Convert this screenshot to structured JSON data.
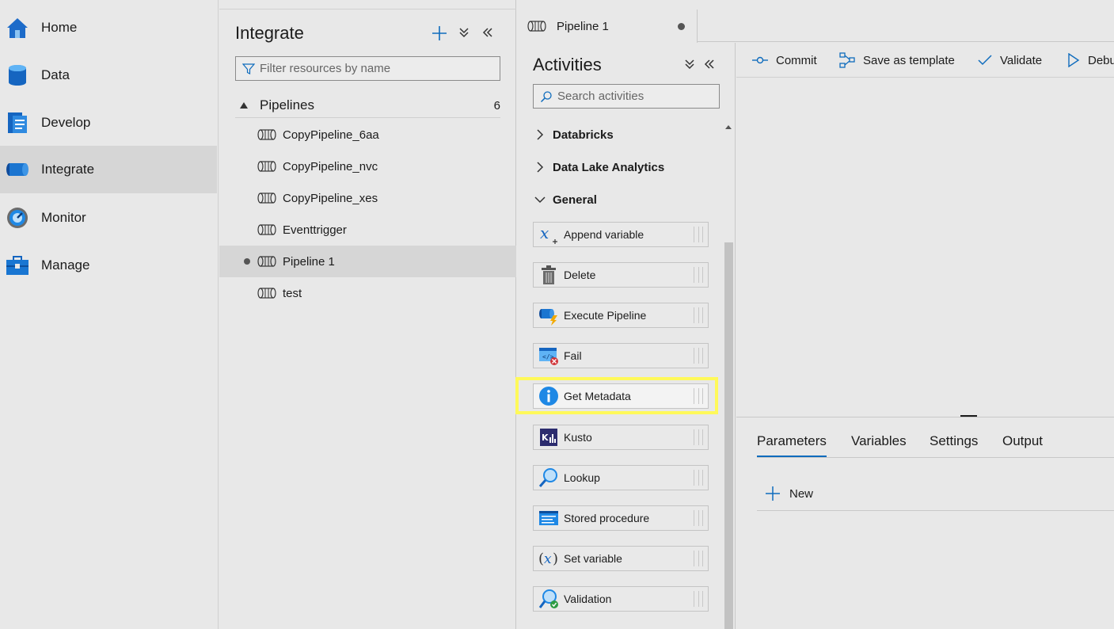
{
  "nav": {
    "items": [
      {
        "label": "Home",
        "icon": "home-icon"
      },
      {
        "label": "Data",
        "icon": "database-icon"
      },
      {
        "label": "Develop",
        "icon": "document-icon"
      },
      {
        "label": "Integrate",
        "icon": "pipeline-icon",
        "active": true
      },
      {
        "label": "Monitor",
        "icon": "gauge-icon"
      },
      {
        "label": "Manage",
        "icon": "toolbox-icon"
      }
    ]
  },
  "integrate": {
    "title": "Integrate",
    "filter_placeholder": "Filter resources by name",
    "section_label": "Pipelines",
    "section_count": "6",
    "pipelines": [
      {
        "label": "CopyPipeline_6aa"
      },
      {
        "label": "CopyPipeline_nvc"
      },
      {
        "label": "CopyPipeline_xes"
      },
      {
        "label": "Eventtrigger"
      },
      {
        "label": "Pipeline 1",
        "selected": true,
        "unsaved": true
      },
      {
        "label": "test"
      }
    ]
  },
  "tab": {
    "label": "Pipeline 1",
    "unsaved": true
  },
  "activities": {
    "title": "Activities",
    "search_placeholder": "Search activities",
    "groups": [
      {
        "label": "Databricks",
        "expanded": false
      },
      {
        "label": "Data Lake Analytics",
        "expanded": false
      },
      {
        "label": "General",
        "expanded": true
      }
    ],
    "items": [
      {
        "label": "Append variable",
        "icon": "append-variable-icon"
      },
      {
        "label": "Delete",
        "icon": "trash-icon"
      },
      {
        "label": "Execute Pipeline",
        "icon": "execute-pipeline-icon"
      },
      {
        "label": "Fail",
        "icon": "fail-icon"
      },
      {
        "label": "Get Metadata",
        "icon": "info-icon",
        "highlighted": true
      },
      {
        "label": "Kusto",
        "icon": "kusto-icon"
      },
      {
        "label": "Lookup",
        "icon": "lookup-icon"
      },
      {
        "label": "Stored procedure",
        "icon": "stored-procedure-icon"
      },
      {
        "label": "Set variable",
        "icon": "set-variable-icon"
      },
      {
        "label": "Validation",
        "icon": "validation-icon"
      }
    ]
  },
  "toolbar": {
    "commit": "Commit",
    "save_template": "Save as template",
    "validate": "Validate",
    "debug": "Debug"
  },
  "bottom": {
    "tabs": [
      "Parameters",
      "Variables",
      "Settings",
      "Output"
    ],
    "active_tab": "Parameters",
    "new_label": "New"
  },
  "colors": {
    "accent": "#0f6cbd",
    "highlight": "#fff95a",
    "background": "#e8e8e8"
  }
}
